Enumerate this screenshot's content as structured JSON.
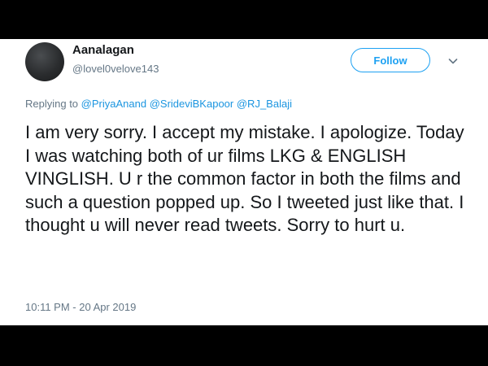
{
  "tweet": {
    "display_name": "Aanalagan",
    "handle": "@lovel0velove143",
    "follow_label": "Follow",
    "replying_to_prefix": "Replying to",
    "replying_to": [
      "@PriyaAnand",
      "@SrideviBKapoor",
      "@RJ_Balaji"
    ],
    "text": "I am very sorry. I accept my mistake. I apologize. Today I was watching both of ur films LKG & ENGLISH VINGLISH. U r the common factor in both the films and such a question popped up. So I tweeted just like that. I thought u will never read tweets. Sorry to hurt u.",
    "timestamp": "10:11 PM - 20 Apr 2019"
  },
  "icons": {
    "menu": "chevron-down-icon"
  },
  "colors": {
    "accent": "#1da1f2",
    "mention": "#1b95e0",
    "secondary_text": "#657786",
    "primary_text": "#14171a",
    "letterbox": "#000000"
  }
}
